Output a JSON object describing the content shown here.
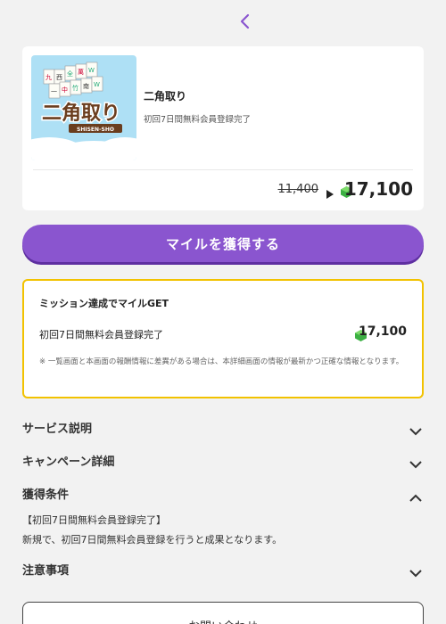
{
  "offer": {
    "title": "二角取り",
    "subtitle": "初回7日間無料会員登録完了",
    "thumb_text_main": "二角取り",
    "thumb_text_sub": "SHISEN-SHO",
    "old_points": "11,400",
    "new_points": "17,100"
  },
  "cta_label": "マイルを獲得する",
  "mission": {
    "title": "ミッション達成でマイルGET",
    "item_label": "初回7日間無料会員登録完了",
    "item_points": "17,100",
    "note": "※ 一覧画面と本画面の報酬情報に差異がある場合は、本詳細画面の情報が最新かつ正確な情報となります。"
  },
  "sections": {
    "service": "サービス説明",
    "campaign": "キャンペーン詳細",
    "conditions": "獲得条件",
    "notes": "注意事項"
  },
  "conditions": {
    "heading": "【初回7日間無料会員登録完了】",
    "text": "新規で、初回7日間無料会員登録を行うと成果となります。"
  },
  "contact_label": "お問い合わせ",
  "colors": {
    "accent": "#8a55cf",
    "mission_border": "#f2c200",
    "gem": "#3cb043"
  }
}
